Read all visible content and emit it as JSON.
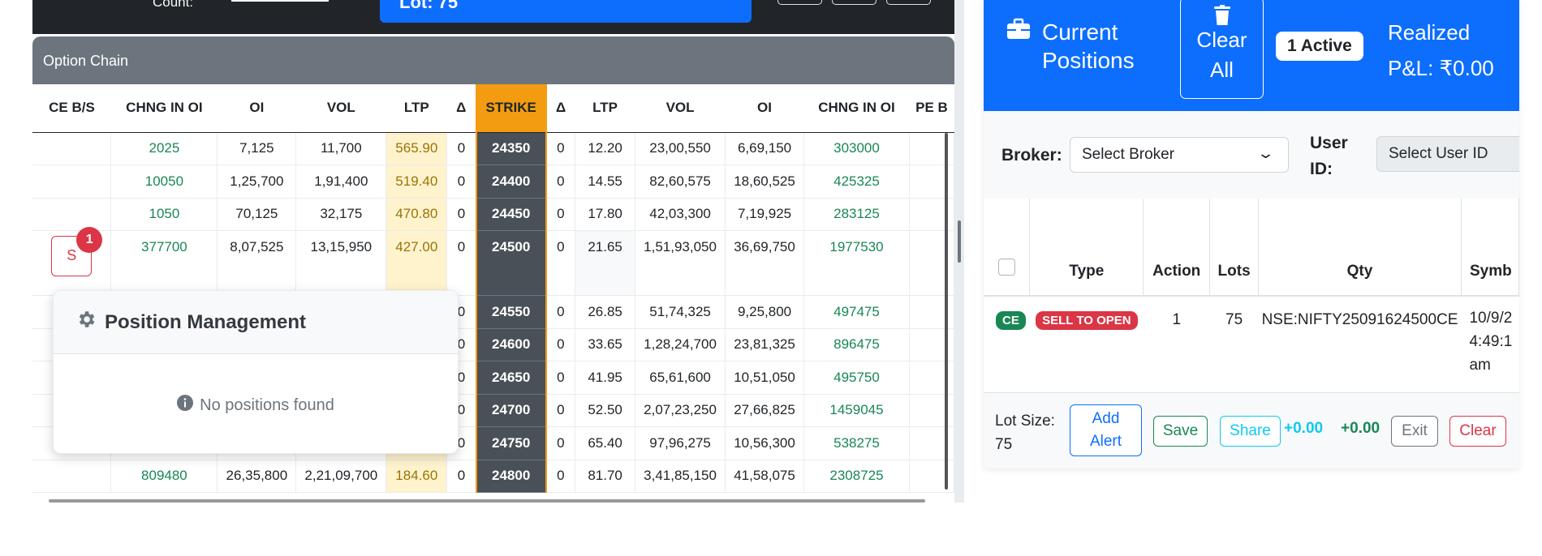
{
  "topbar": {
    "count_label": "Count:",
    "lot_label": "Lot: 75"
  },
  "option_chain": {
    "title": "Option Chain",
    "headers": [
      "CE B/S",
      "CHNG IN OI",
      "OI",
      "VOL",
      "LTP",
      "Δ",
      "STRIKE",
      "Δ",
      "LTP",
      "VOL",
      "OI",
      "CHNG IN OI",
      "PE B"
    ],
    "rows": [
      {
        "ce_chg": "2025",
        "ce_oi": "7,125",
        "ce_vol": "11,700",
        "ce_ltp": "565.90",
        "ce_d": "0",
        "strike": "24350",
        "pe_d": "0",
        "pe_ltp": "12.20",
        "pe_vol": "23,00,550",
        "pe_oi": "6,69,150",
        "pe_chg": "303000"
      },
      {
        "ce_chg": "10050",
        "ce_oi": "1,25,700",
        "ce_vol": "1,91,400",
        "ce_ltp": "519.40",
        "ce_d": "0",
        "strike": "24400",
        "pe_d": "0",
        "pe_ltp": "14.55",
        "pe_vol": "82,60,575",
        "pe_oi": "18,60,525",
        "pe_chg": "425325"
      },
      {
        "ce_chg": "1050",
        "ce_oi": "70,125",
        "ce_vol": "32,175",
        "ce_ltp": "470.80",
        "ce_d": "0",
        "strike": "24450",
        "pe_d": "0",
        "pe_ltp": "17.80",
        "pe_vol": "42,03,300",
        "pe_oi": "7,19,925",
        "pe_chg": "283125"
      },
      {
        "ce_chg": "377700",
        "ce_oi": "8,07,525",
        "ce_vol": "13,15,950",
        "ce_ltp": "427.00",
        "ce_d": "0",
        "strike": "24500",
        "pe_d": "0",
        "pe_ltp": "21.65",
        "pe_vol": "1,51,93,050",
        "pe_oi": "36,69,750",
        "pe_chg": "1977530"
      },
      {
        "ce_chg": "",
        "ce_oi": "",
        "ce_vol": "",
        "ce_ltp": "",
        "ce_d": "0",
        "strike": "24550",
        "pe_d": "0",
        "pe_ltp": "26.85",
        "pe_vol": "51,74,325",
        "pe_oi": "9,25,800",
        "pe_chg": "497475"
      },
      {
        "ce_chg": "",
        "ce_oi": "",
        "ce_vol": "",
        "ce_ltp": "",
        "ce_d": "0",
        "strike": "24600",
        "pe_d": "0",
        "pe_ltp": "33.65",
        "pe_vol": "1,28,24,700",
        "pe_oi": "23,81,325",
        "pe_chg": "896475"
      },
      {
        "ce_chg": "",
        "ce_oi": "",
        "ce_vol": "",
        "ce_ltp": "",
        "ce_d": "0",
        "strike": "24650",
        "pe_d": "0",
        "pe_ltp": "41.95",
        "pe_vol": "65,61,600",
        "pe_oi": "10,51,050",
        "pe_chg": "495750"
      },
      {
        "ce_chg": "",
        "ce_oi": "",
        "ce_vol": "",
        "ce_ltp": "",
        "ce_d": "0",
        "strike": "24700",
        "pe_d": "0",
        "pe_ltp": "52.50",
        "pe_vol": "2,07,23,250",
        "pe_oi": "27,66,825",
        "pe_chg": "1459045"
      },
      {
        "ce_chg": "",
        "ce_oi": "",
        "ce_vol": "",
        "ce_ltp": "",
        "ce_d": "0",
        "strike": "24750",
        "pe_d": "0",
        "pe_ltp": "65.40",
        "pe_vol": "97,96,275",
        "pe_oi": "10,56,300",
        "pe_chg": "538275"
      },
      {
        "ce_chg": "809480",
        "ce_oi": "26,35,800",
        "ce_vol": "2,21,09,700",
        "ce_ltp": "184.60",
        "ce_d": "0",
        "strike": "24800",
        "pe_d": "0",
        "pe_ltp": "81.70",
        "pe_vol": "3,41,85,150",
        "pe_oi": "41,58,075",
        "pe_chg": "2308725"
      }
    ],
    "sell_button_label": "S",
    "sell_badge_count": "1"
  },
  "position_management": {
    "title": "Position Management",
    "empty_text": "No positions found"
  },
  "positions_panel": {
    "title": "Current Positions",
    "clear_all_label": "Clear All",
    "active_badge": "1 Active",
    "realized_label": "Realized",
    "realized_value": "P&L: ₹0.00",
    "broker_label": "Broker:",
    "broker_select": "Select Broker",
    "user_id_label": "User ID:",
    "user_id_select": "Select User ID",
    "table_headers": [
      "Type",
      "Action",
      "Lots",
      "Qty",
      "Symb"
    ],
    "row": {
      "type": "CE",
      "action": "SELL TO OPEN",
      "lots": "1",
      "qty": "75",
      "symbol": "NSE:NIFTY25091624500CE",
      "time": "10/9/2 4:49:1 am"
    },
    "footer": {
      "lot_size": "Lot Size: 75",
      "add_alert": "Add Alert",
      "save": "Save",
      "share": "Share",
      "pnl_a": "+0.00",
      "pnl_b": "+0.00",
      "exit": "Exit",
      "clear": "Clear"
    }
  },
  "colors": {
    "primary": "#0d6efd",
    "strike_header": "#f39c12",
    "strike_cell": "#495057",
    "ltp_bg": "#fff3cd",
    "green": "#198754",
    "red": "#dc3545"
  }
}
